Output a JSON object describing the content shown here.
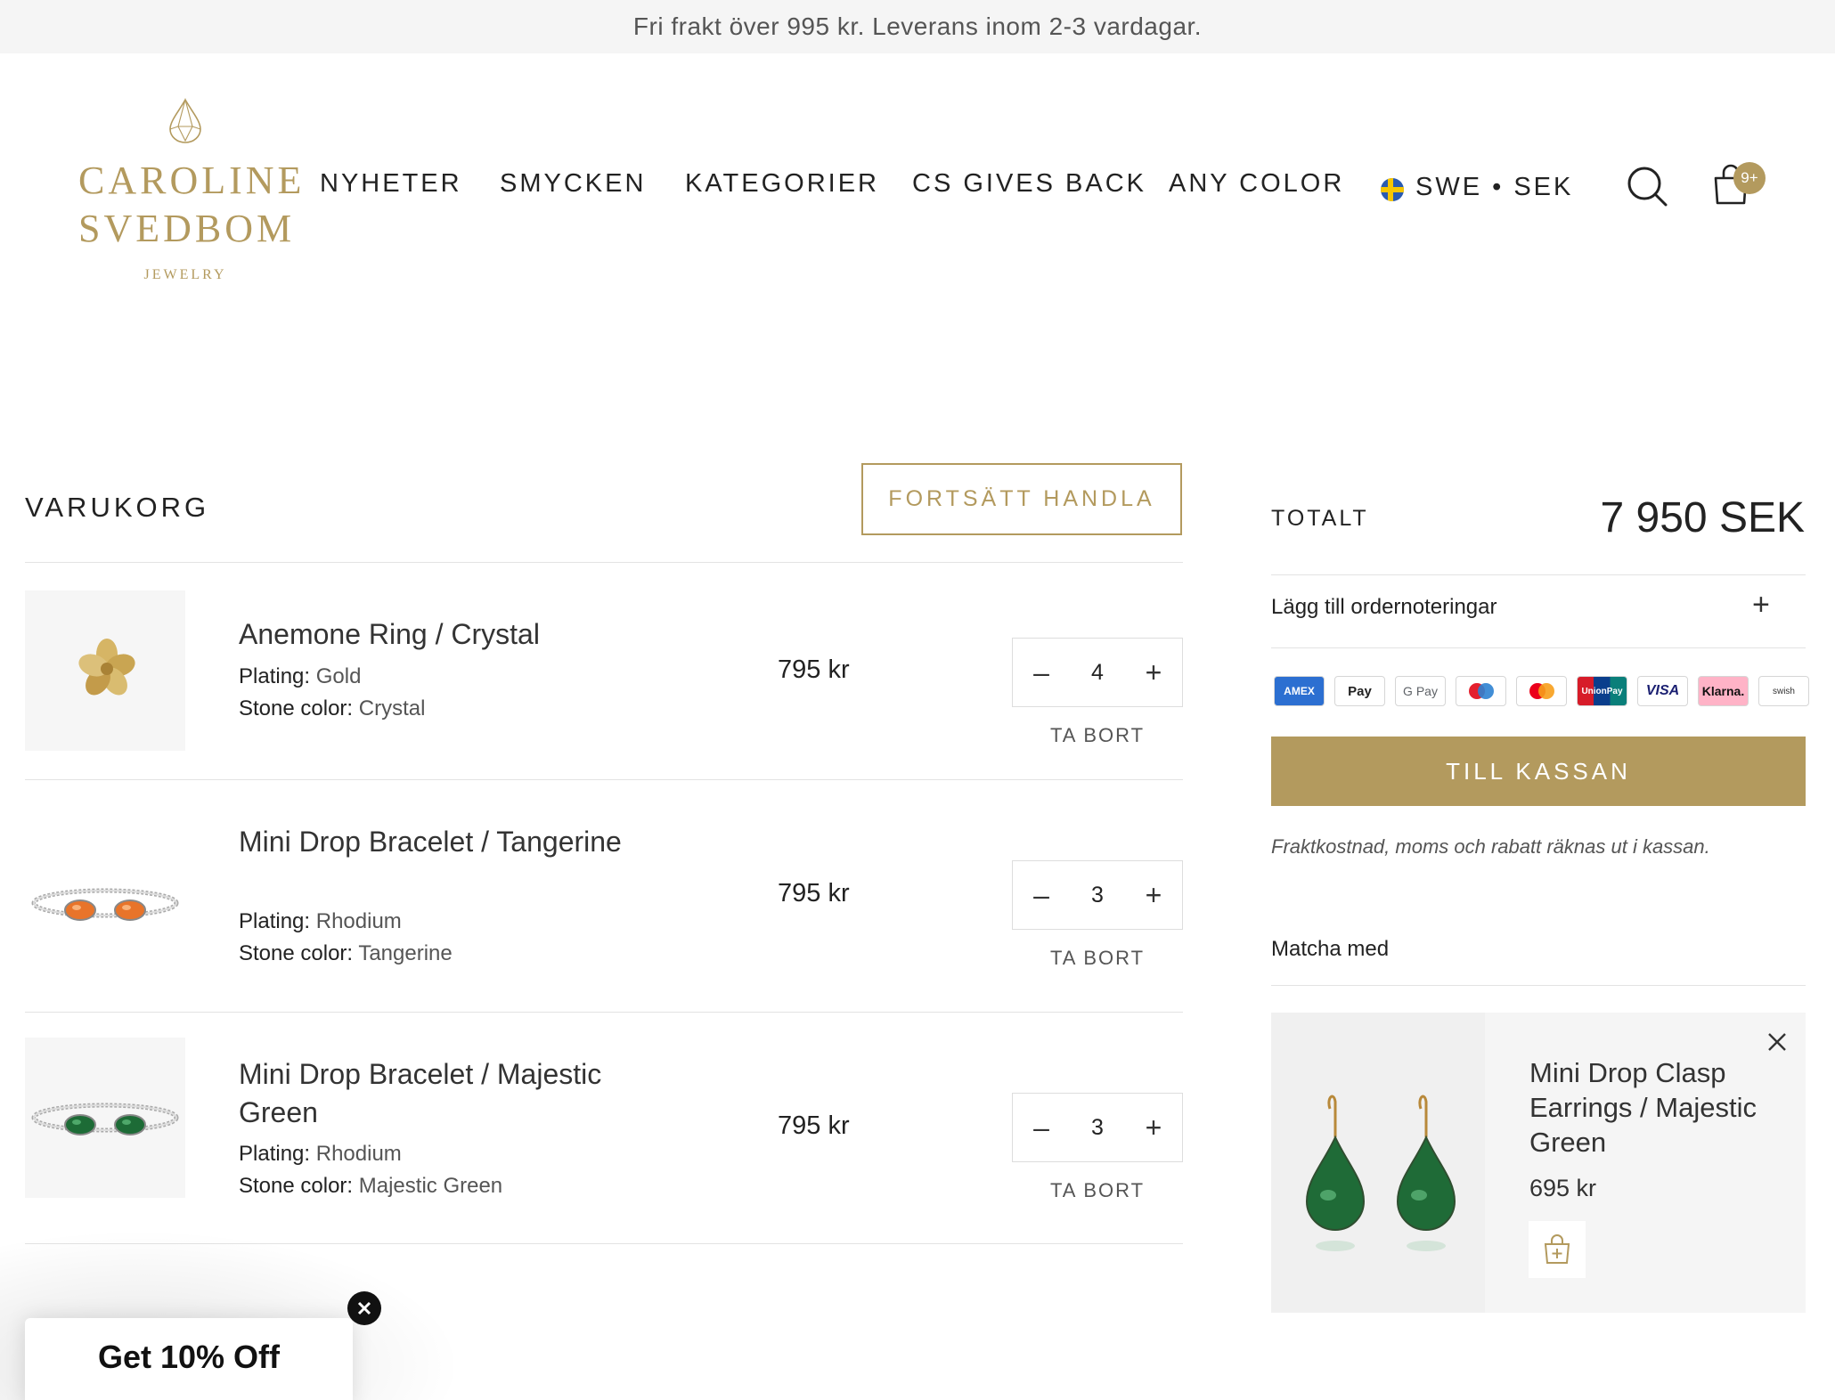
{
  "announcement": "Fri frakt över 995 kr. Leverans inom 2-3 vardagar.",
  "brand": {
    "line1": "CAROLINE",
    "line2": "SVEDBOM",
    "sub": "JEWELRY",
    "color": "#b39a5e"
  },
  "nav": {
    "items": [
      "NYHETER",
      "SMYCKEN",
      "KATEGORIER",
      "CS GIVES BACK",
      "ANY COLOR"
    ],
    "locale": "SWE • SEK",
    "cart_count": "9+"
  },
  "cart": {
    "title": "VARUKORG",
    "continue_label": "FORTSÄTT HANDLA",
    "remove_label": "TA BORT",
    "attr_plating": "Plating:",
    "attr_stone": "Stone color:",
    "items": [
      {
        "name": "Anemone Ring / Crystal",
        "plating": "Gold",
        "stone": "Crystal",
        "price": "795 kr",
        "qty": "4"
      },
      {
        "name": "Mini Drop Bracelet / Tangerine",
        "plating": "Rhodium",
        "stone": "Tangerine",
        "price": "795 kr",
        "qty": "3"
      },
      {
        "name": "Mini Drop Bracelet / Majestic Green",
        "plating": "Rhodium",
        "stone": "Majestic Green",
        "price": "795 kr",
        "qty": "3"
      }
    ]
  },
  "summary": {
    "total_label": "TOTALT",
    "total_value": "7 950 SEK",
    "notes_label": "Lägg till ordernoteringar",
    "payment_methods": [
      "AMEX",
      "Pay",
      "G Pay",
      "Maestro",
      "Mastercard",
      "UnionPay",
      "VISA",
      "Klarna.",
      "swish"
    ],
    "checkout_label": "TILL KASSAN",
    "shipping_note": "Fraktkostnad, moms och rabatt räknas ut i kassan.",
    "match_title": "Matcha med"
  },
  "recommendation": {
    "name": "Mini Drop Clasp Earrings / Majestic Green",
    "price": "695 kr"
  },
  "promo": {
    "label": "Get 10% Off"
  }
}
